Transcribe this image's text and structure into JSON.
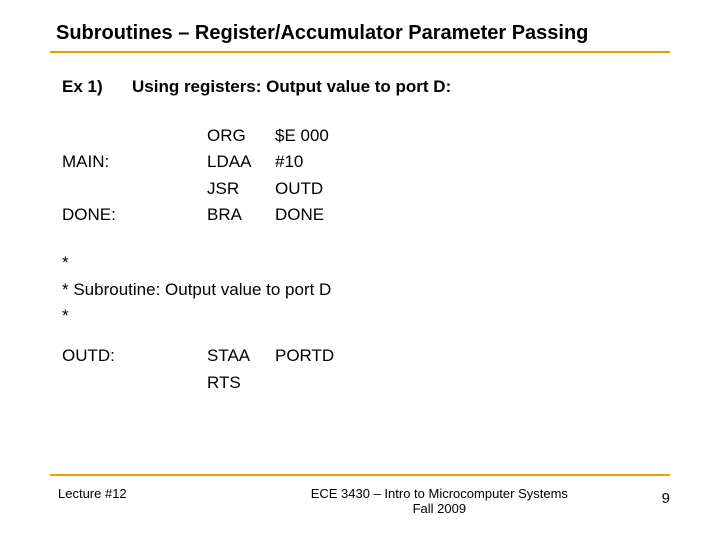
{
  "title": "Subroutines – Register/Accumulator Parameter Passing",
  "ex": {
    "label": "Ex 1)",
    "text": "Using registers:  Output value to port D:"
  },
  "code": [
    {
      "label": "",
      "mnem": "ORG",
      "op": "$E 000"
    },
    {
      "label": "MAIN:",
      "mnem": "LDAA",
      "op": "#10"
    },
    {
      "label": "",
      "mnem": "JSR",
      "op": "OUTD"
    },
    {
      "label": "DONE:",
      "mnem": "BRA",
      "op": "DONE"
    }
  ],
  "comments": [
    "*",
    "* Subroutine:  Output value to port D",
    "*"
  ],
  "sub": [
    {
      "label": "OUTD:",
      "mnem": "STAA",
      "op": "PORTD"
    },
    {
      "label": "",
      "mnem": "RTS",
      "op": ""
    }
  ],
  "footer": {
    "left": "Lecture #12",
    "center1": "ECE 3430 – Intro to Microcomputer Systems",
    "center2": "Fall 2009",
    "pagenum": "9"
  }
}
